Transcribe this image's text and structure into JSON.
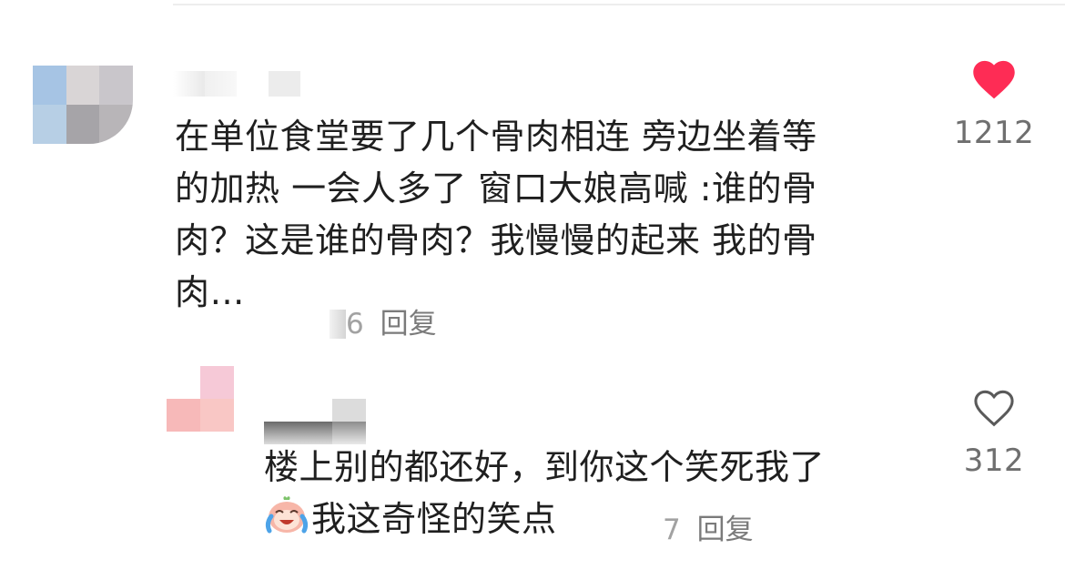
{
  "comments": [
    {
      "text_lines": [
        "在单位食堂要了几个骨肉相连 旁边坐着等",
        "的加热 一会人多了 窗口大娘高喊 :谁的骨",
        "肉？这是谁的骨肉？我慢慢的起来 我的骨",
        "肉…"
      ],
      "time_partial": "6",
      "reply_label": "回复",
      "likes": "1212",
      "liked": true
    },
    {
      "text_lines": [
        "楼上别的都还好，到你这个笑死我了",
        "我这奇怪的笑点"
      ],
      "emoji": "laughing-crying-emoji",
      "time_partial": "7",
      "reply_label": "回复",
      "likes": "312",
      "liked": false
    }
  ],
  "colors": {
    "heart_active": "#fe2c55",
    "heart_outline": "#5a5a5a",
    "meta_text": "#8a8a8a"
  }
}
